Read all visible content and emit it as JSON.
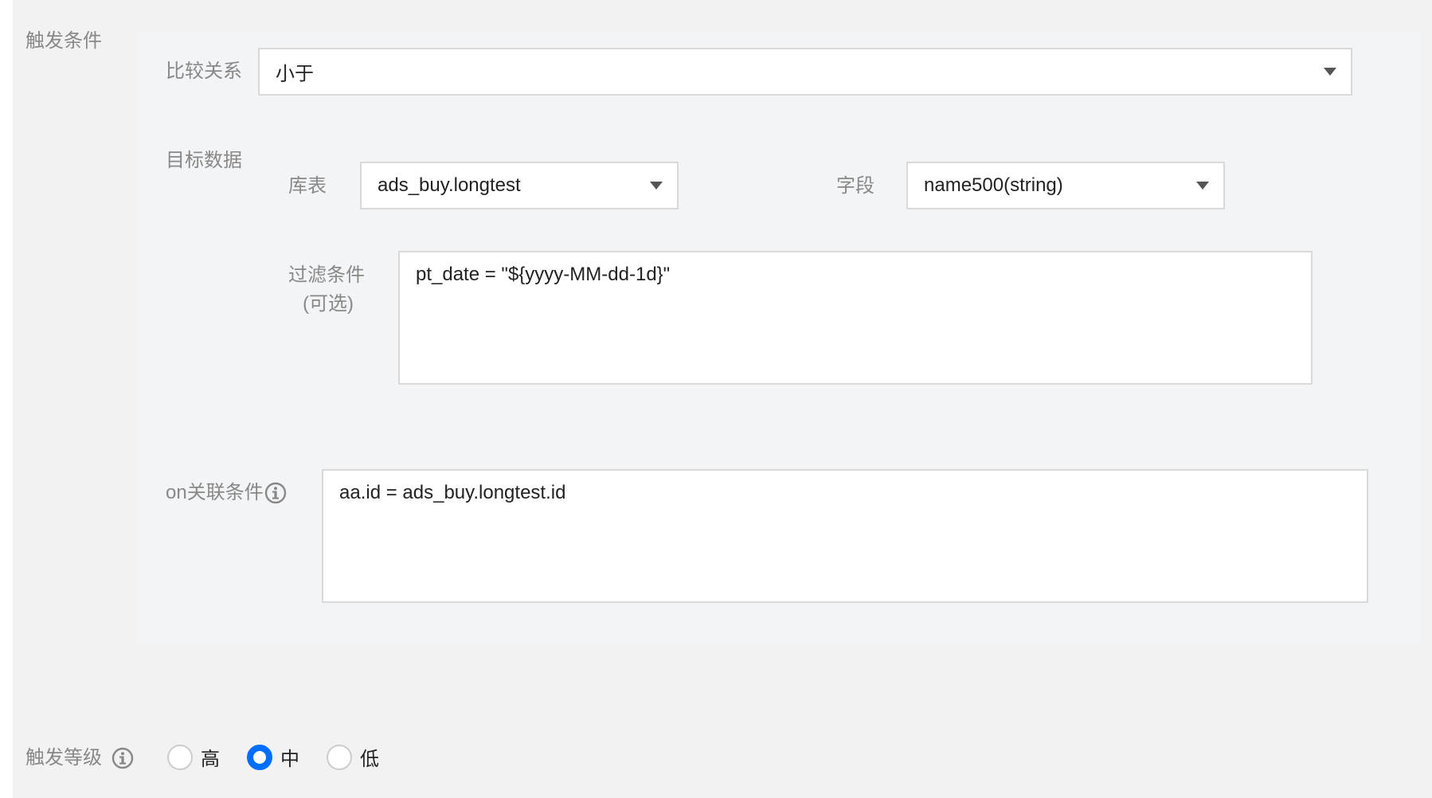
{
  "trigger_condition": {
    "label": "触发条件",
    "comparison": {
      "label": "比较关系",
      "value": "小于"
    },
    "target_data": {
      "label": "目标数据",
      "table": {
        "label": "库表",
        "value": "ads_buy.longtest"
      },
      "field": {
        "label": "字段",
        "value": "name500(string)"
      },
      "filter": {
        "label": "过滤条件",
        "label_optional": "(可选)",
        "value": "pt_date = \"${yyyy-MM-dd-1d}\""
      }
    },
    "on_condition": {
      "label": "on关联条件",
      "value": "aa.id = ads_buy.longtest.id"
    }
  },
  "trigger_level": {
    "label": "触发等级",
    "options": [
      {
        "label": "高",
        "checked": false
      },
      {
        "label": "中",
        "checked": true
      },
      {
        "label": "低",
        "checked": false
      }
    ]
  },
  "colors": {
    "accent": "#006eff",
    "label": "#888888",
    "panel": "#f3f4f6",
    "background": "#f2f2f2"
  }
}
